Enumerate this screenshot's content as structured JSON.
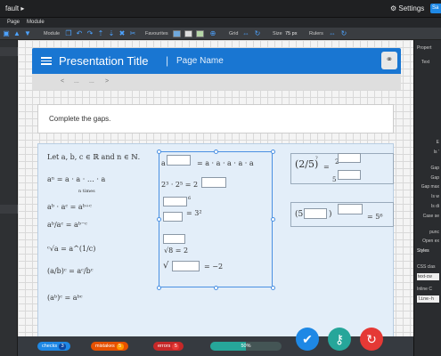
{
  "topbar": {
    "title": "fault ▸",
    "settings": "⚙ Settings",
    "save": "Sa"
  },
  "menubar": {
    "items": [
      "Page",
      "Module"
    ]
  },
  "toolbar": {
    "module_label": "Module",
    "favourites_label": "Favourites",
    "grid_label": "Grid",
    "size_label": "Size",
    "size_value": "75 px",
    "rulers_label": "Rulers"
  },
  "header": {
    "title": "Presentation Title",
    "separator": "|",
    "page_name": "Page Name"
  },
  "nav": {
    "prev": "<",
    "dots1": "...",
    "dots2": "...",
    "next": ">"
  },
  "instruction": "Complete the gaps.",
  "math": {
    "intro": "Let a, b, c ∈ ℝ and n ∈ ℕ.",
    "left_rules": [
      "aⁿ = a · a · … · a",
      "n times",
      "aᵇ · aᶜ = aᵇ⁺ᶜ",
      "aᵇ/aᶜ = aᵇ⁻ᶜ",
      "ᶜ√a = a^(1/c)",
      "(a/b)ᶜ = aᶜ/bᶜ",
      "(aᵇ)ᶜ = aᵇᶜ"
    ],
    "middle": [
      "= a · a · a · a · a",
      "2³ · 2⁵ = 2",
      "6",
      "= 3²",
      "√8 = 2",
      "= −2"
    ],
    "right": [
      "(2/5)",
      "?",
      "=",
      "2",
      "5",
      "(5",
      ")",
      "= 5⁶"
    ]
  },
  "status": {
    "checks_label": "checks",
    "checks_count": "3",
    "mistakes_label": "mistakes",
    "mistakes_count": "5",
    "errors_label": "errors",
    "errors_count": "5",
    "progress_label": "50%",
    "progress_value": 0.5
  },
  "rightpanel": {
    "tab": "Text",
    "items": [
      "Propert",
      "Text",
      "E",
      "Is ‘",
      "Gap",
      "Gap",
      "Gap max",
      "Is w",
      "Is di",
      "Case se",
      "punc",
      "Open ex",
      "Styles",
      "CSS clas",
      "text-cw",
      "Inline C",
      "line-h"
    ]
  },
  "colors": {
    "accent": "#1976d2",
    "checks": "#1e88e5",
    "mistakes": "#e65100",
    "errors": "#c62828",
    "progress": "#26a69a"
  }
}
